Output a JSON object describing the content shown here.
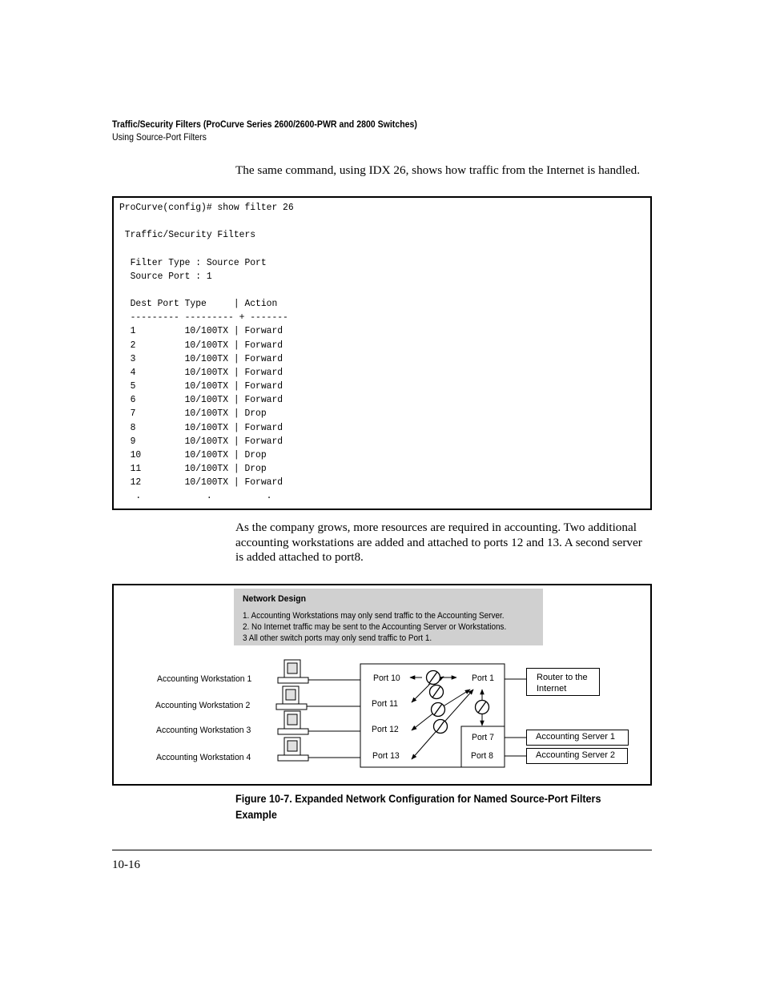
{
  "header": {
    "title": "Traffic/Security Filters  (ProCurve Series 2600/2600-PWR and 2800 Switches)",
    "subtitle": "Using Source-Port Filters"
  },
  "intro_paragraph": "The same command, using IDX 26, shows how traffic from the Internet is handled.",
  "cli_output": {
    "prompt_line": "ProCurve(config)# show filter 26",
    "section_title": "Traffic/Security Filters",
    "filter_type_line": "Filter Type : Source Port",
    "source_port_line": "Source Port : 1",
    "columns": [
      "Dest Port",
      "Type",
      "Action"
    ],
    "rows": [
      {
        "port": "1",
        "type": "10/100TX",
        "action": "Forward"
      },
      {
        "port": "2",
        "type": "10/100TX",
        "action": "Forward"
      },
      {
        "port": "3",
        "type": "10/100TX",
        "action": "Forward"
      },
      {
        "port": "4",
        "type": "10/100TX",
        "action": "Forward"
      },
      {
        "port": "5",
        "type": "10/100TX",
        "action": "Forward"
      },
      {
        "port": "6",
        "type": "10/100TX",
        "action": "Forward"
      },
      {
        "port": "7",
        "type": "10/100TX",
        "action": "Drop"
      },
      {
        "port": "8",
        "type": "10/100TX",
        "action": "Forward"
      },
      {
        "port": "9",
        "type": "10/100TX",
        "action": "Forward"
      },
      {
        "port": "10",
        "type": "10/100TX",
        "action": "Drop"
      },
      {
        "port": "11",
        "type": "10/100TX",
        "action": "Drop"
      },
      {
        "port": "12",
        "type": "10/100TX",
        "action": "Forward"
      }
    ],
    "continuation": ".            .          ."
  },
  "growth_paragraph": "As the company grows, more resources are required in accounting. Two additional accounting workstations are added and attached to ports 12 and 13. A second server is added attached to port8.",
  "figure": {
    "design_box": {
      "title": "Network Design",
      "rules": [
        "1. Accounting Workstations may only send traffic to the Accounting Server.",
        "2. No Internet traffic may be sent to the Accounting Server or Workstations.",
        "3 All other switch ports may only send traffic to Port 1."
      ]
    },
    "workstations": [
      "Accounting Workstation 1",
      "Accounting Workstation 2",
      "Accounting Workstation 3",
      "Accounting Workstation 4"
    ],
    "switch_ports_left": [
      "Port 10",
      "Port 11",
      "Port 12",
      "Port 13"
    ],
    "switch_port_uplink": "Port 1",
    "switch_ports_server": [
      "Port 7",
      "Port 8"
    ],
    "router_label": "Router to the Internet",
    "router_lines": [
      "Router to the",
      "Internet"
    ],
    "servers": [
      "Accounting Server 1",
      "Accounting Server 2"
    ],
    "caption": "Figure 10-7. Expanded Network Configuration for Named Source-Port Filters Example"
  },
  "footer": {
    "page_number": "10-16"
  }
}
